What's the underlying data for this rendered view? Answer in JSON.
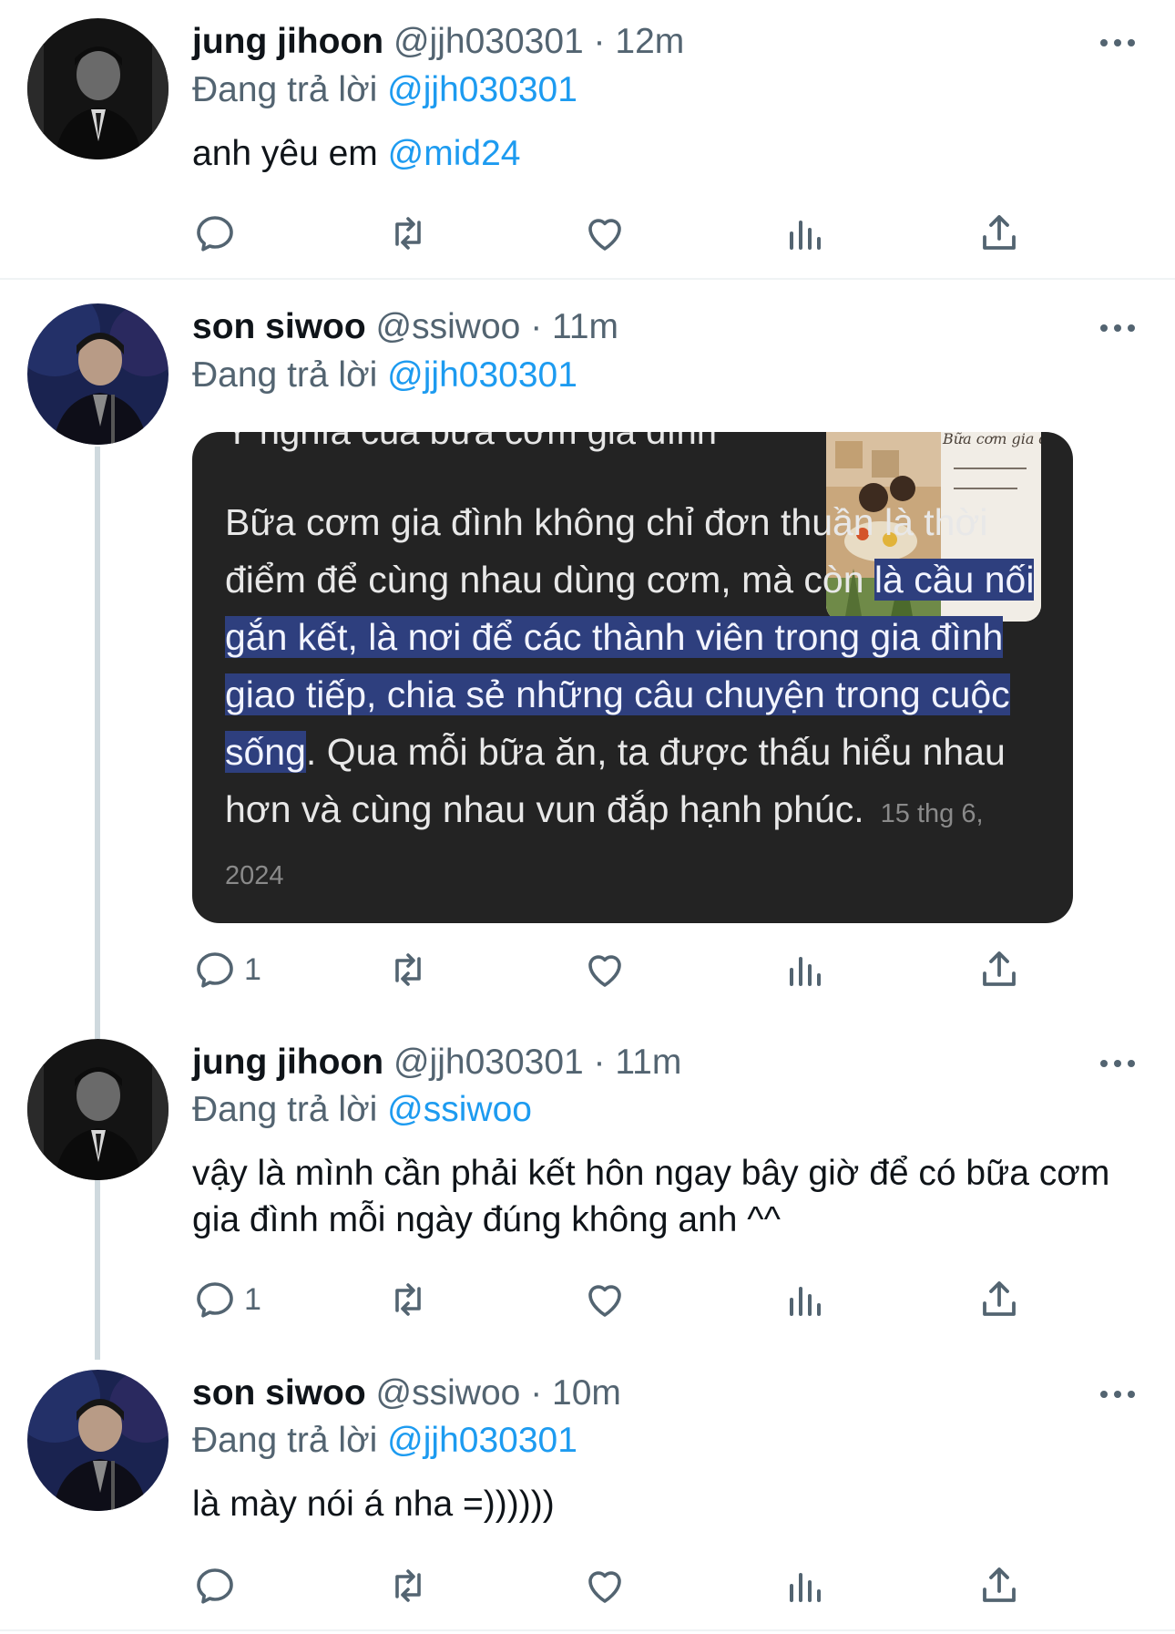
{
  "tweets": [
    {
      "name": "jung jihoon",
      "handle": "@jjh030301",
      "dot": "·",
      "time": "12m",
      "reply_prefix": "Đang trả lời",
      "reply_to": "@jjh030301",
      "text": "anh yêu em",
      "text_mention": "@mid24",
      "reply_count": ""
    },
    {
      "name": "son siwoo",
      "handle": "@ssiwoo",
      "dot": "·",
      "time": "11m",
      "reply_prefix": "Đang trả lời",
      "reply_to": "@jjh030301",
      "reply_count": "1",
      "media": {
        "title": "Ý nghĩa của bữa cơm gia đình",
        "text_before": "Bữa cơm gia đình không chỉ đơn thuần là thời điểm để cùng nhau dùng cơm, mà còn ",
        "text_highlight": "là cầu nối gắn kết, là nơi để các thành viên trong gia đình giao tiếp, chia sẻ những câu chuyện trong cuộc sống",
        "text_after": ". Qua mỗi bữa ăn, ta được thấu hiểu nhau hơn và cùng nhau vun đắp hạnh phúc.",
        "date": "15 thg 6, 2024",
        "thumb_caption": "Bữa cơm gia đ"
      }
    },
    {
      "name": "jung jihoon",
      "handle": "@jjh030301",
      "dot": "·",
      "time": "11m",
      "reply_prefix": "Đang trả lời",
      "reply_to": "@ssiwoo",
      "text": "vậy là mình cần phải kết hôn ngay bây giờ để có bữa cơm gia đình mỗi ngày đúng không anh ^^",
      "reply_count": "1"
    },
    {
      "name": "son siwoo",
      "handle": "@ssiwoo",
      "dot": "·",
      "time": "10m",
      "reply_prefix": "Đang trả lời",
      "reply_to": "@jjh030301",
      "text": "là mày nói á nha =))))))",
      "reply_count": ""
    }
  ],
  "icons": [
    "reply-icon",
    "retweet-icon",
    "like-icon",
    "views-icon",
    "share-icon",
    "more-icon"
  ],
  "colors": {
    "accent": "#1d9bf0",
    "secondary_text": "#536471",
    "highlight": "#2e3f7e",
    "media_bg": "#232323"
  }
}
